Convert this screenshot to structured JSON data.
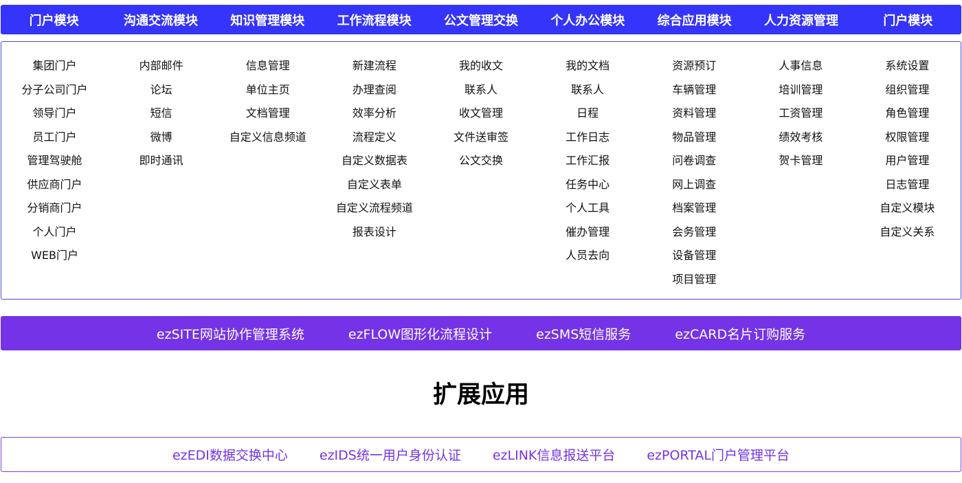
{
  "header": {
    "modules": [
      "门户模块",
      "沟通交流模块",
      "知识管理模块",
      "工作流程模块",
      "公文管理交换",
      "个人办公模块",
      "综合应用模块",
      "人力资源管理",
      "门户模块"
    ]
  },
  "columns": [
    [
      "集团门户",
      "分子公司门户",
      "领导门户",
      "员工门户",
      "管理驾驶舱",
      "供应商门户",
      "分销商门户",
      "个人门户",
      "WEB门户"
    ],
    [
      "内部邮件",
      "论坛",
      "短信",
      "微博",
      "即时通讯"
    ],
    [
      "信息管理",
      "单位主页",
      "文档管理",
      "自定义信息频道"
    ],
    [
      "新建流程",
      "办理查阅",
      "效率分析",
      "流程定义",
      "自定义数据表",
      "自定义表单",
      "自定义流程频道",
      "报表设计"
    ],
    [
      "我的收文",
      "联系人",
      "收文管理",
      "文件送审签",
      "公文交换"
    ],
    [
      "我的文档",
      "联系人",
      "日程",
      "工作日志",
      "工作汇报",
      "任务中心",
      "个人工具",
      "催办管理",
      "人员去向"
    ],
    [
      "资源预订",
      "车辆管理",
      "资料管理",
      "物品管理",
      "问卷调查",
      "网上调查",
      "档案管理",
      "会务管理",
      "设备管理",
      "项目管理"
    ],
    [
      "人事信息",
      "培训管理",
      "工资管理",
      "绩效考核",
      "贺卡管理"
    ],
    [
      "系统设置",
      "组织管理",
      "角色管理",
      "权限管理",
      "用户管理",
      "日志管理",
      "自定义模块",
      "自定义关系"
    ]
  ],
  "ext_bar": {
    "items": [
      "ezSITE网站协作管理系统",
      "ezFLOW图形化流程设计",
      "ezSMS短信服务",
      "ezCARD名片订购服务"
    ]
  },
  "section": {
    "title": "扩展应用"
  },
  "ext_box": {
    "items": [
      "ezEDI数据交换中心",
      "ezIDS统一用户身份认证",
      "ezLINK信息报送平台",
      "ezPORTAL门户管理平台"
    ]
  },
  "colors": {
    "header_bg": "#3434fa",
    "panel_border": "#4a4ad8",
    "ext_bar_bg": "#7433e6",
    "ext_box_text": "#7433e6"
  }
}
